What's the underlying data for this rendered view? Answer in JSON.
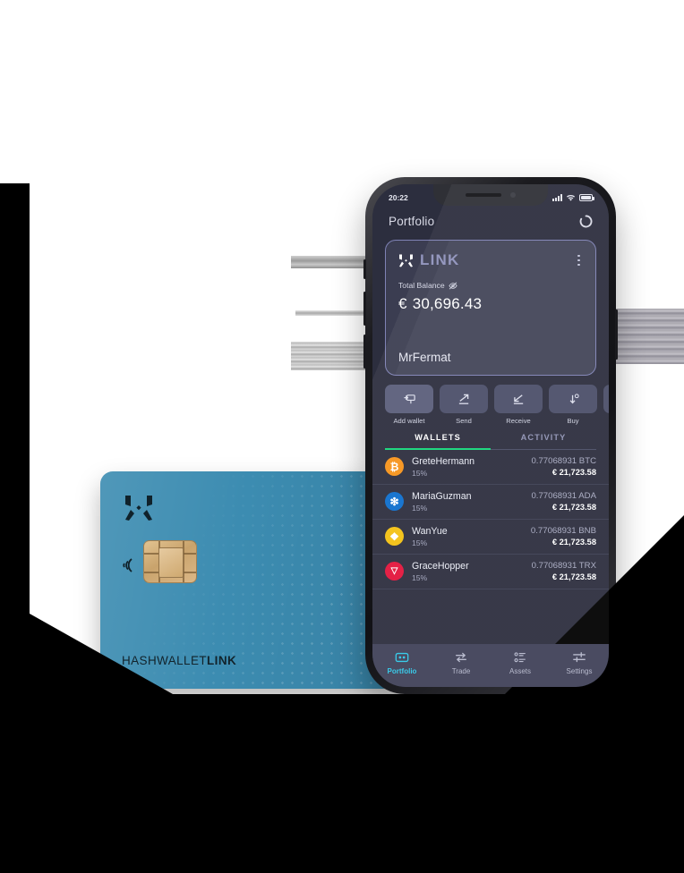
{
  "status_bar": {
    "time": "20:22",
    "icons": [
      "signal-icon",
      "wifi-icon",
      "battery-icon"
    ]
  },
  "header": {
    "title": "Portfolio",
    "refresh_icon": "refresh-icon"
  },
  "balance_card": {
    "brand": "LINK",
    "logo_icon": "hashwallet-logo-icon",
    "menu_icon": "kebab-menu-icon",
    "balance_label": "Total Balance",
    "hide_icon": "eye-off-icon",
    "currency_symbol": "€",
    "amount": "30,696.43",
    "account_name": "MrFermat"
  },
  "actions": [
    {
      "label": "Add wallet",
      "icon": "add-wallet-icon"
    },
    {
      "label": "Send",
      "icon": "arrow-up-right-icon"
    },
    {
      "label": "Receive",
      "icon": "arrow-down-left-icon"
    },
    {
      "label": "Buy",
      "icon": "buy-arrow-icon"
    }
  ],
  "tabs": [
    {
      "label": "WALLETS",
      "active": true
    },
    {
      "label": "ACTIVITY",
      "active": false
    }
  ],
  "wallets": [
    {
      "name": "GreteHermann",
      "percent": "15%",
      "amount": "0.77068931 BTC",
      "fiat": "€ 21,723.58",
      "symbol": "BTC",
      "color": "#f7931a",
      "glyph": "₿"
    },
    {
      "name": "MariaGuzman",
      "percent": "15%",
      "amount": "0.77068931 ADA",
      "fiat": "€ 21,723.58",
      "symbol": "ADA",
      "color": "#0d6ecd",
      "glyph": "❇"
    },
    {
      "name": "WanYue",
      "percent": "15%",
      "amount": "0.77068931 BNB",
      "fiat": "€ 21,723.58",
      "symbol": "BNB",
      "color": "#f3c111",
      "glyph": "❖"
    },
    {
      "name": "GraceHopper",
      "percent": "15%",
      "amount": "0.77068931 TRX",
      "fiat": "€ 21,723.58",
      "symbol": "TRX",
      "color": "#e3143b",
      "glyph": "▽"
    }
  ],
  "bottom_nav": [
    {
      "label": "Portfolio",
      "icon": "portfolio-icon",
      "active": true
    },
    {
      "label": "Trade",
      "icon": "trade-swap-icon",
      "active": false
    },
    {
      "label": "Assets",
      "icon": "assets-list-icon",
      "active": false
    },
    {
      "label": "Settings",
      "icon": "settings-sliders-icon",
      "active": false
    }
  ],
  "hardware_card": {
    "brand_regular": "HASHWALLET",
    "brand_bold": "LINK",
    "logo_icon": "hashwallet-logo-icon",
    "nfc_icon": "nfc-contactless-icon",
    "chip_icon": "emv-chip-icon",
    "card_color": "#3c8cb1"
  },
  "theme": {
    "screen_bg": "#2c2e3e",
    "accent_green": "#14d67a",
    "accent_cyan": "#2fc8e8",
    "card_border": "#7f82b5"
  }
}
